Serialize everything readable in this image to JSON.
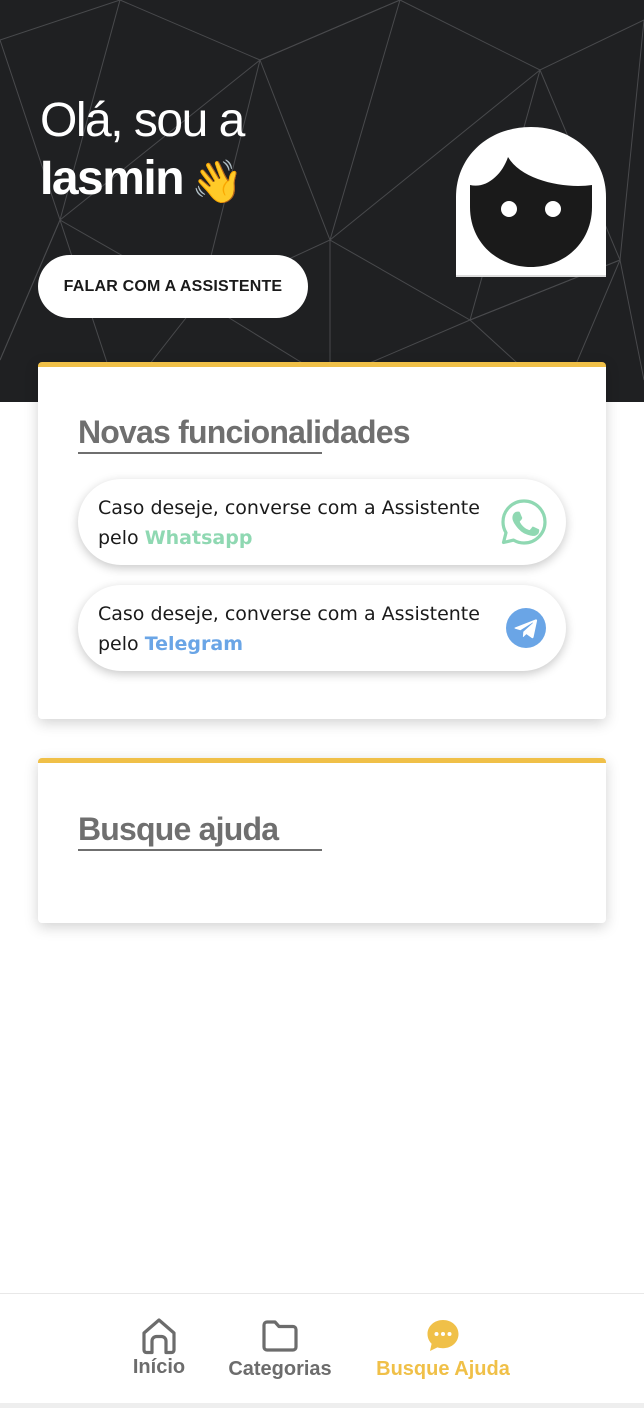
{
  "hero": {
    "greeting_line1": "Olá, sou a",
    "greeting_line2": "Iasmin",
    "wave_emoji": "👋",
    "cta_label": "FALAR COM A ASSISTENTE",
    "avatar_icon": "assistant-avatar-icon",
    "background_color": "#1f2022"
  },
  "features": {
    "title": "Novas funcionalidades",
    "items": [
      {
        "text_line1": "Caso deseje, converse com a Assistente",
        "text_prefix": "pelo ",
        "channel": "Whatsapp",
        "icon": "whatsapp-icon",
        "color": "#8fd8b2"
      },
      {
        "text_line1": "Caso deseje, converse com a Assistente",
        "text_prefix": "pelo ",
        "channel": "Telegram",
        "icon": "telegram-icon",
        "color": "#6aa5e6"
      }
    ]
  },
  "help": {
    "title": "Busque ajuda"
  },
  "nav": {
    "items": [
      {
        "label": "Início",
        "icon": "home-icon",
        "active": false
      },
      {
        "label": "Categorias",
        "icon": "folder-icon",
        "active": false
      },
      {
        "label": "Busque Ajuda",
        "icon": "chat-icon",
        "active": true
      }
    ]
  },
  "colors": {
    "accent": "#f0c048",
    "title_gray": "#6f6f6f",
    "whatsapp": "#8fd8b2",
    "telegram": "#6aa5e6"
  }
}
